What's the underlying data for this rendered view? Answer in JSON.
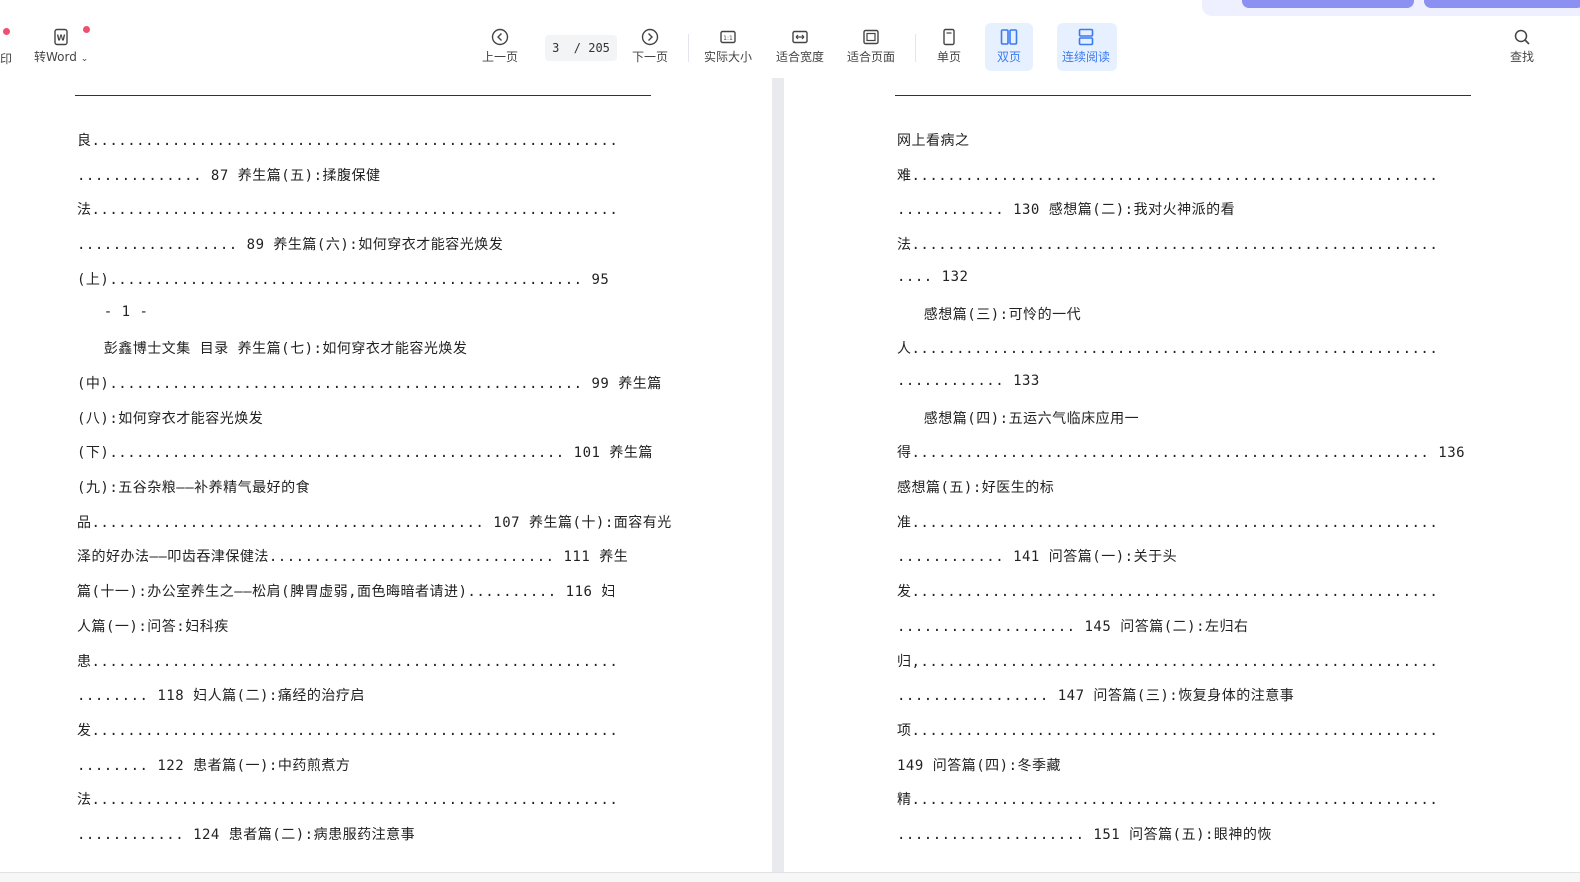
{
  "toolbar": {
    "print_label": "印",
    "to_word_label": "转Word",
    "prev_label": "上一页",
    "page_current": "3",
    "page_total": "/ 205",
    "next_label": "下一页",
    "actual_size_label": "实际大小",
    "fit_width_label": "适合宽度",
    "fit_page_label": "适合页面",
    "single_label": "单页",
    "double_label": "双页",
    "continuous_label": "连续阅读",
    "search_label": "查找",
    "accent_color": "#3a7bf0"
  },
  "left_page": {
    "lines": [
      "良...........................................................",
      ".............. 87 养生篇(五):揉腹保健",
      "法...........................................................",
      ".................. 89 养生篇(六):如何穿衣才能容光焕发",
      "(上)..................................................... 95",
      "   - 1 -",
      "   彭鑫博士文集 目录 养生篇(七):如何穿衣才能容光焕发",
      "(中)..................................................... 99 养生篇",
      "(八):如何穿衣才能容光焕发",
      "(下)................................................... 101 养生篇",
      "(九):五谷杂粮——补养精气最好的食",
      "品............................................ 107 养生篇(十):面容有光",
      "泽的好办法——叩齿吞津保健法................................ 111 养生",
      "篇(十一):办公室养生之——松肩(脾胃虚弱,面色晦暗者请进).......... 116 妇",
      "人篇(一):问答:妇科疾",
      "患...........................................................",
      "........ 118 妇人篇(二):痛经的治疗启",
      "发...........................................................",
      "........ 122 患者篇(一):中药煎煮方",
      "法...........................................................",
      "............ 124 患者篇(二):病患服药注意事"
    ]
  },
  "right_page": {
    "lines": [
      "网上看病之",
      "难...........................................................",
      "............ 130 感想篇(二):我对火神派的看",
      "法...........................................................",
      ".... 132",
      "   感想篇(三):可怜的一代",
      "人...........................................................",
      "............ 133",
      "   感想篇(四):五运六气临床应用一",
      "得.......................................................... 136",
      "感想篇(五):好医生的标",
      "准...........................................................",
      "............ 141 问答篇(一):关于头",
      "发...........................................................",
      ".................... 145 问答篇(二):左归右",
      "归,..........................................................",
      "................. 147 问答篇(三):恢复身体的注意事",
      "项...........................................................",
      "149 问答篇(四):冬季藏",
      "精...........................................................",
      "..................... 151 问答篇(五):眼神的恢"
    ]
  }
}
